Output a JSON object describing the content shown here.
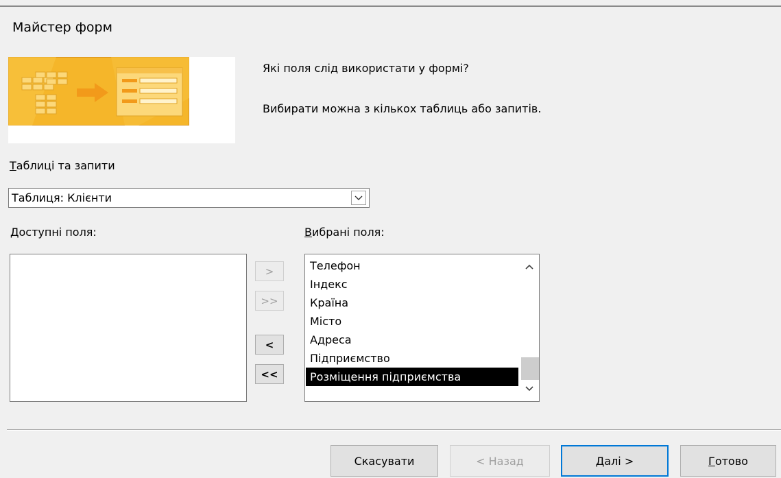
{
  "window": {
    "title": "Майстер форм"
  },
  "header": {
    "question": "Які поля слід використати у формі?",
    "hint": "Вибирати можна з кількох таблиць або запитів."
  },
  "tables": {
    "label_hotkey": "Т",
    "label_rest": "аблиці та запити",
    "selected_value": "Таблиця: Клієнти"
  },
  "available": {
    "label_hotkey": "Д",
    "label_rest": "оступні поля:",
    "items": []
  },
  "selected": {
    "label_hotkey": "В",
    "label_rest": "ибрані поля:",
    "items": [
      "Телефон",
      "Індекс",
      "Країна",
      "Місто",
      "Адреса",
      "Підприємство",
      "Розміщення підприємства"
    ],
    "highlighted": "Розміщення підприємства"
  },
  "move_buttons": {
    "add_one": ">",
    "add_all": ">>",
    "remove_one": "<",
    "remove_all": "<<"
  },
  "footer": {
    "cancel_label": "Скасувати",
    "back_label": "< Назад",
    "next_hotkey": "Д",
    "next_rest": "алі >",
    "finish_hotkey": "Г",
    "finish_rest": "отово"
  },
  "colors": {
    "accent": "#0078d7",
    "banner_orange": "#f5b62a",
    "selection": "#000000"
  },
  "icons": {
    "dropdown": "chevron-down-icon",
    "scroll_up": "chevron-up-icon",
    "scroll_down": "chevron-down-icon",
    "wizard_banner": "form-wizard-illustration"
  }
}
